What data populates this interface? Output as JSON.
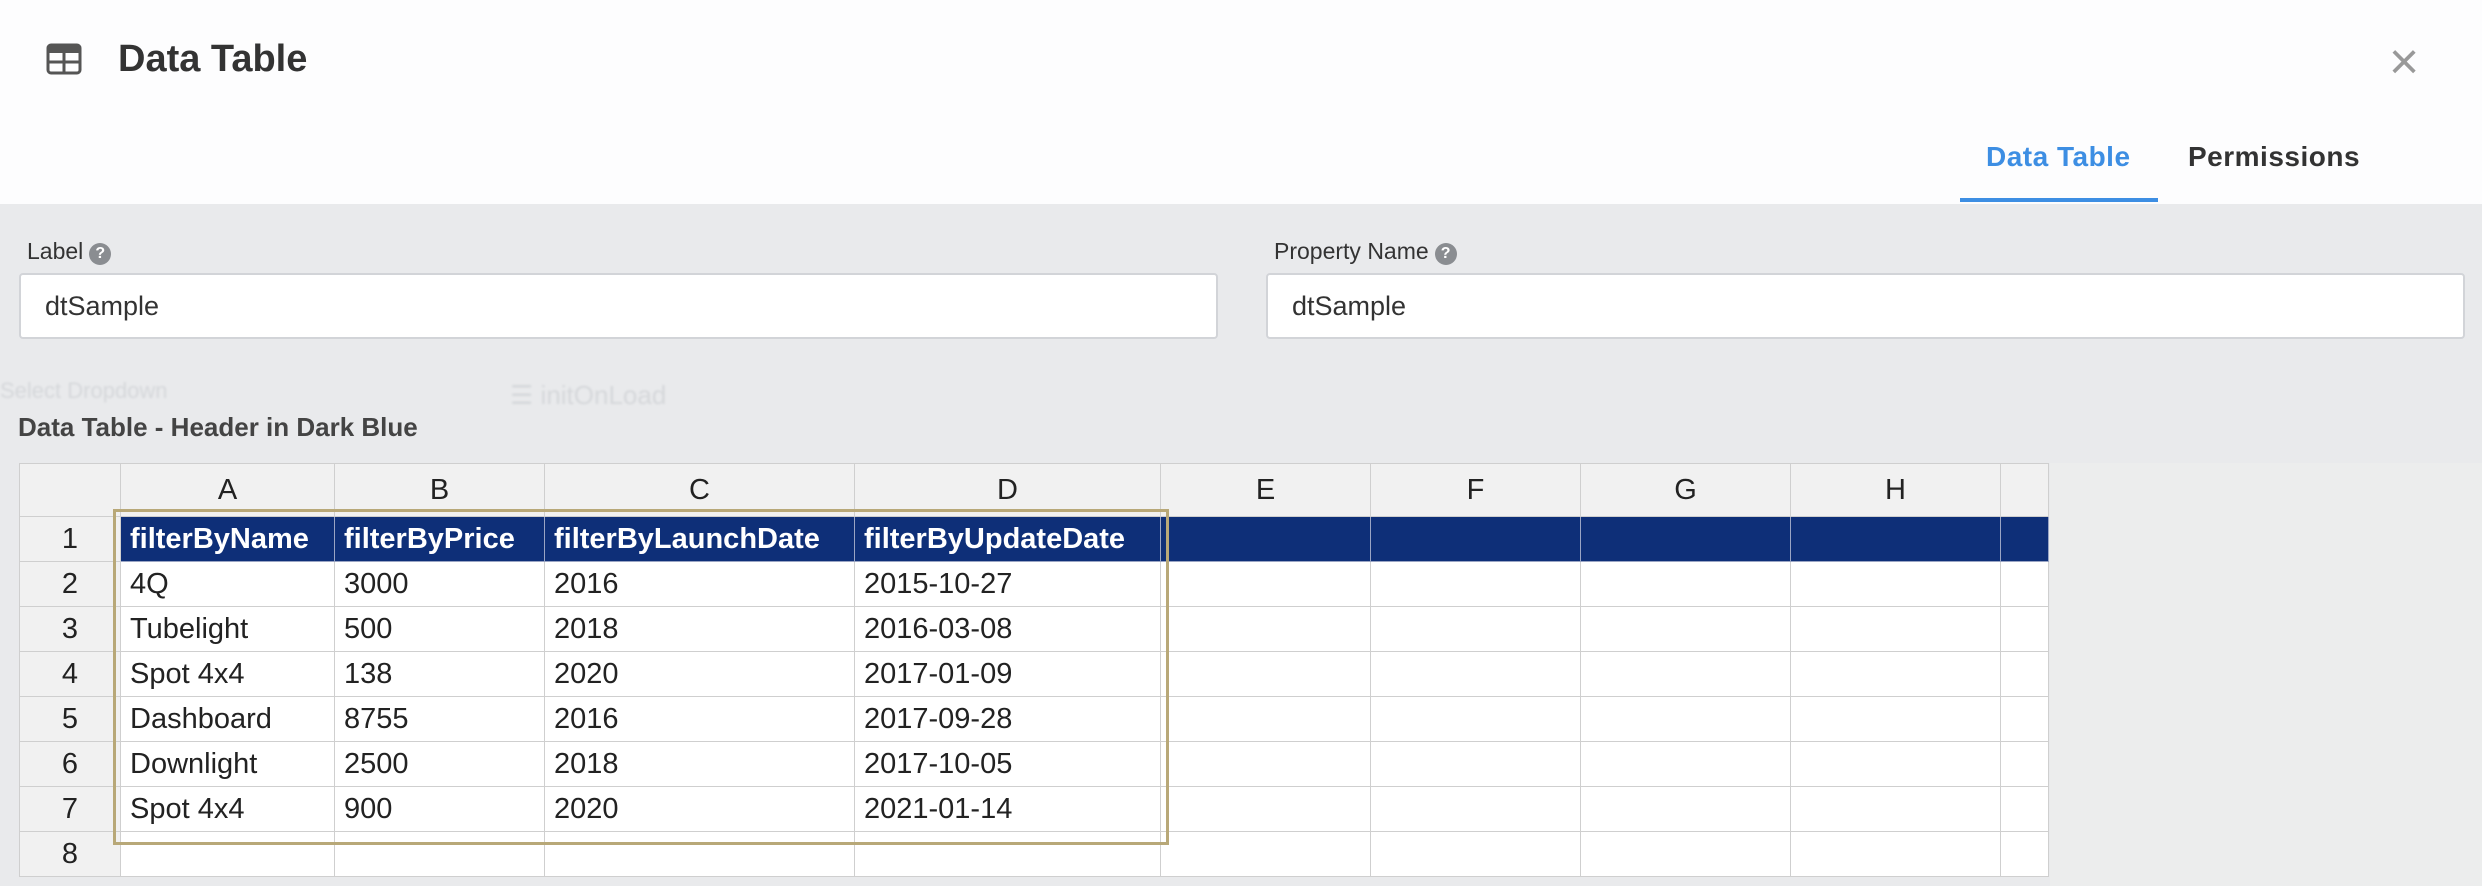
{
  "header": {
    "icon": "table-icon",
    "title": "Data Table",
    "close_glyph": "×",
    "tabs": [
      {
        "label": "Data Table",
        "active": true
      },
      {
        "label": "Permissions",
        "active": false
      }
    ]
  },
  "ghost": {
    "select_dropdown": "Select Dropdown",
    "init_on_load": "initOnLoad"
  },
  "form": {
    "label_field": {
      "label": "Label",
      "help_glyph": "?",
      "value": "dtSample"
    },
    "property_field": {
      "label": "Property Name",
      "help_glyph": "?",
      "value": "dtSample"
    }
  },
  "table": {
    "section_title": "Data Table - Header in Dark Blue",
    "column_letters": [
      "A",
      "B",
      "C",
      "D",
      "E",
      "F",
      "G",
      "H"
    ],
    "row_numbers": [
      "1",
      "2",
      "3",
      "4",
      "5",
      "6",
      "7",
      "8"
    ],
    "header_row": [
      "filterByName",
      "filterByPrice",
      "filterByLaunchDate",
      "filterByUpdateDate"
    ],
    "rows": [
      [
        "4Q",
        "3000",
        "2016",
        "2015-10-27"
      ],
      [
        "Tubelight",
        "500",
        "2018",
        "2016-03-08"
      ],
      [
        "Spot 4x4",
        "138",
        "2020",
        "2017-01-09"
      ],
      [
        "Dashboard",
        "8755",
        "2016",
        "2017-09-28"
      ],
      [
        "Downlight",
        "2500",
        "2018",
        "2017-10-05"
      ],
      [
        "Spot 4x4",
        "900",
        "2020",
        "2021-01-14"
      ]
    ],
    "header_color": "#0e2f78",
    "selection_color": "#b8a878"
  },
  "colors": {
    "accent": "#3d8ee3",
    "background": "#e9eaec"
  }
}
